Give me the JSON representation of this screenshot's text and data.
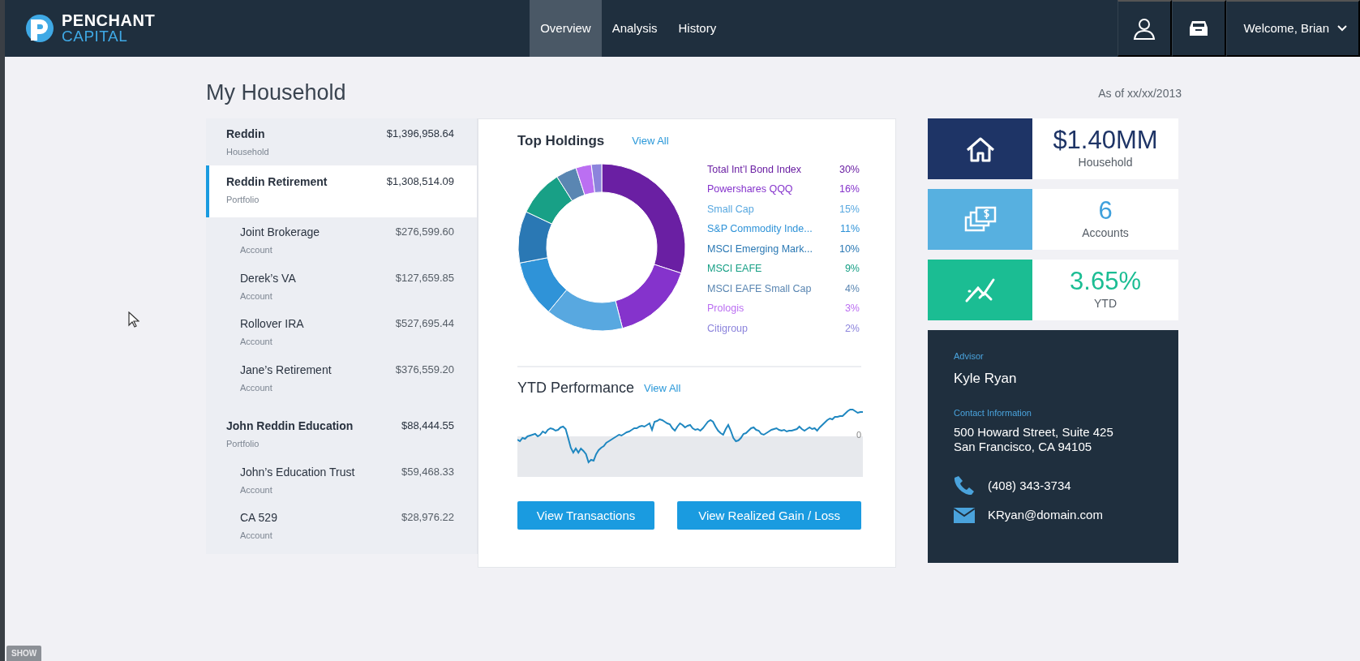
{
  "header": {
    "brand": {
      "line_1": "PENCHANT",
      "line_2": "CAPITAL"
    },
    "nav": [
      {
        "label": "Overview",
        "selected": true
      },
      {
        "label": "Analysis",
        "selected": false
      },
      {
        "label": "History",
        "selected": false
      }
    ],
    "welcome": "Welcome, Brian"
  },
  "title": "My Household",
  "as_of": "As of xx/xx/2013",
  "tree": [
    {
      "name": "Reddin",
      "type": "Household",
      "value": "$1,396,958.64",
      "selected": false,
      "children": [
        {
          "name": "Reddin Retirement",
          "type": "Portfolio",
          "value": "$1,308,514.09",
          "selected": true,
          "children": [
            {
              "name": "Joint Brokerage",
              "type": "Account",
              "value": "$276,599.60",
              "selected": false
            },
            {
              "name": "Derek’s VA",
              "type": "Account",
              "value": "$127,659.85",
              "selected": false
            },
            {
              "name": "Rollover IRA",
              "type": "Account",
              "value": "$527,695.44",
              "selected": false
            },
            {
              "name": "Jane’s Retirement",
              "type": "Account",
              "value": "$376,559.20",
              "selected": false
            }
          ]
        },
        {
          "name": "John Reddin Education",
          "type": "Portfolio",
          "value": "$88,444.55",
          "selected": false,
          "children": [
            {
              "name": "John’s Education Trust",
              "type": "Account",
              "value": "$59,468.33",
              "selected": false
            },
            {
              "name": "CA 529",
              "type": "Account",
              "value": "$28,976.22",
              "selected": false
            }
          ]
        }
      ]
    }
  ],
  "top_holdings": {
    "title": "Top Holdings",
    "view_all": "View All",
    "chart_data": {
      "type": "donut",
      "categories": [
        "Total Int’l Bond Index",
        "Powershares QQQ",
        "Small Cap",
        "S&P Commodity Inde...",
        "MSCI Emerging Mark...",
        "MSCI EAFE",
        "MSCI EAFE Small Cap",
        "Prologis",
        "Citigroup"
      ],
      "values": [
        30,
        16,
        15,
        11,
        10,
        9,
        4,
        3,
        2
      ],
      "value_labels": [
        "30%",
        "16%",
        "15%",
        "11%",
        "10%",
        "9%",
        "4%",
        "3%",
        "2%"
      ],
      "colors": [
        "#6a1fa3",
        "#8533cc",
        "#58a8e0",
        "#2f93d8",
        "#2a78b4",
        "#18a086",
        "#5a86b2",
        "#bb6ff2",
        "#8c84dc"
      ]
    }
  },
  "ytd_performance": {
    "title": "YTD Performance",
    "view_all": "View All",
    "zero_label": "0"
  },
  "buttons": [
    "View Transactions",
    "View Realized Gain / Loss"
  ],
  "stats": [
    {
      "kind": "household",
      "value": "$1.40MM",
      "label": "Household"
    },
    {
      "kind": "accounts",
      "value": "6",
      "label": "Accounts"
    },
    {
      "kind": "ytd",
      "value": "3.65%",
      "label": "YTD"
    }
  ],
  "advisor": {
    "label": "Advisor",
    "name": "Kyle Ryan",
    "contact_label": "Contact Information",
    "address": [
      "500 Howard Street, Suite 425",
      "San Francisco, CA 94105"
    ],
    "phone": "(408) 343-3734",
    "email": "KRyan@domain.com"
  },
  "show_tab": "SHOW"
}
